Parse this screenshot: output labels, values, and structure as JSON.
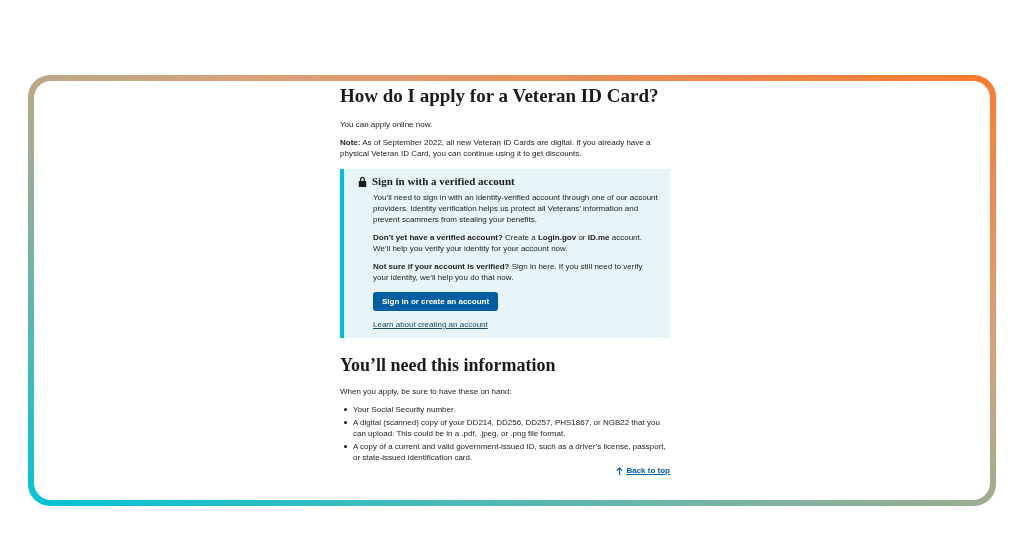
{
  "heading": "How do I apply for a Veteran ID Card?",
  "intro": "You can apply online now.",
  "note": "**Note:** As of September 2022, all new Veteran ID Cards are digital. If you already have a physical Veteran ID Card, you can continue using it to get discounts.",
  "signin_box": {
    "title": "Sign in with a verified account",
    "paragraphs": [
      "You’ll need to sign in with an identity-verified account through one of our account providers. Identity verification helps us protect all Veterans’ information and prevent scammers from stealing your benefits.",
      "**Don’t yet have a verified account?** Create a **Login.gov** or **ID.me** account. We’ll help you verify your identity for your account now.",
      "**Not sure if your account is verified?** Sign in here. If you still need to verify your identity, we’ll help you do that now."
    ],
    "button": "Sign in or create an account",
    "link": "Learn about creating an account"
  },
  "section_heading": "You’ll need this information",
  "section_intro": "When you apply, be sure to have these on hand:",
  "items": [
    "Your Social Security number.",
    "A digital (scanned) copy of your DD214, DD256, DD257, PHS1867, or NGB22 that you can upload. This could be in a .pdf, .jpeg, or .png file format.",
    "A copy of a current and valid government-issued ID, such as a driver’s license, passport, or state-issued identification card."
  ],
  "back_to_top": "Back to top"
}
